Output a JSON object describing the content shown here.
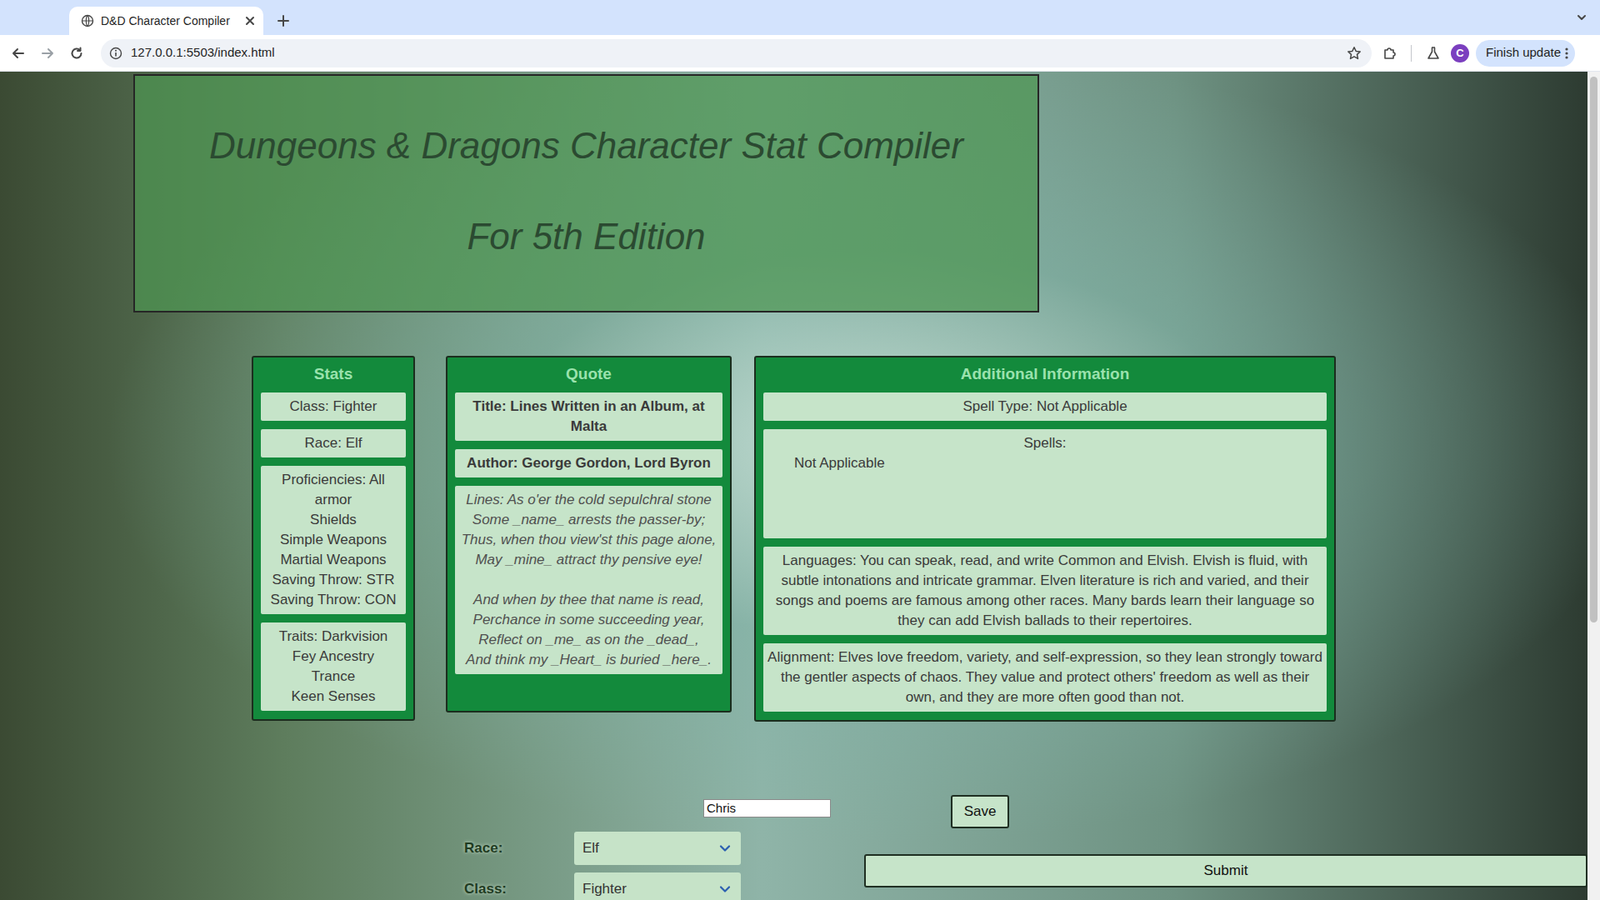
{
  "browser": {
    "tab_title": "D&D Character Compiler",
    "url": "127.0.0.1:5503/index.html",
    "profile_initial": "C",
    "update_button": "Finish update"
  },
  "header": {
    "title": "Dungeons & Dragons Character Stat Compiler",
    "subtitle": "For 5th Edition"
  },
  "stats": {
    "heading": "Stats",
    "items": [
      {
        "lines": [
          "Class: Fighter"
        ]
      },
      {
        "lines": [
          "Race: Elf"
        ]
      },
      {
        "lines": [
          "Proficiencies: All armor",
          "Shields",
          "Simple Weapons",
          "Martial Weapons",
          "Saving Throw: STR",
          "Saving Throw: CON"
        ]
      },
      {
        "lines": [
          "Traits: Darkvision",
          "Fey Ancestry",
          "Trance",
          "Keen Senses"
        ]
      }
    ]
  },
  "quote": {
    "heading": "Quote",
    "title": "Title: Lines Written in an Album, at Malta",
    "author": "Author: George Gordon, Lord Byron",
    "stanzas": [
      [
        "Lines: As o'er the cold sepulchral stone",
        "Some _name_ arrests the passer-by;",
        "Thus, when thou view'st this page alone,",
        "May _mine_ attract thy pensive eye!"
      ],
      [
        "And when by thee that name is read,",
        "Perchance in some succeeding year,",
        "Reflect on _me_ as on the _dead_,",
        "And think my _Heart_ is buried _here_."
      ]
    ]
  },
  "additional": {
    "heading": "Additional Information",
    "spell_type": "Spell Type: Not Applicable",
    "spells_label": "Spells:",
    "spells": [
      "Not Applicable"
    ],
    "languages": "Languages: You can speak, read, and write Common and Elvish. Elvish is fluid, with subtle intonations and intricate grammar. Elven literature is rich and varied, and their songs and poems are famous among other races. Many bards learn their language so they can add Elvish ballads to their repertoires.",
    "alignment": "Alignment: Elves love freedom, variety, and self-expression, so they lean strongly toward the gentler aspects of chaos. They value and protect others' freedom as well as their own, and they are more often good than not."
  },
  "form": {
    "name_value": "Chris",
    "save": "Save",
    "race_label": "Race:",
    "race_value": "Elf",
    "class_label": "Class:",
    "class_value": "Fighter",
    "submit": "Submit"
  }
}
